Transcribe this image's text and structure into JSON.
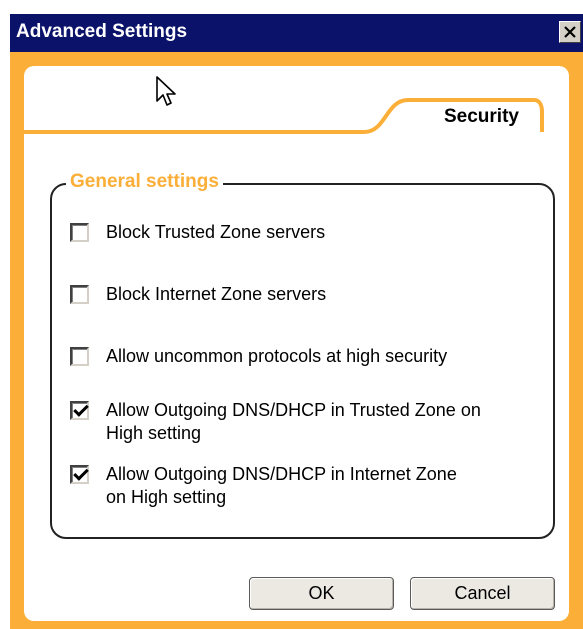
{
  "window": {
    "title": "Advanced Settings"
  },
  "tab": {
    "label": "Security"
  },
  "group": {
    "legend": "General settings",
    "options": [
      {
        "label": "Block Trusted Zone servers",
        "checked": false
      },
      {
        "label": "Block Internet Zone servers",
        "checked": false
      },
      {
        "label": "Allow uncommon protocols at high security",
        "checked": false
      },
      {
        "label": "Allow Outgoing DNS/DHCP in Trusted Zone on High setting",
        "checked": true
      },
      {
        "label": "Allow Outgoing DNS/DHCP in Internet Zone on High setting",
        "checked": true
      }
    ]
  },
  "buttons": {
    "ok": "OK",
    "cancel": "Cancel"
  },
  "colors": {
    "title_bar": "#0a126a",
    "accent": "#fbaf38"
  },
  "icons": {
    "close": "close-icon",
    "cursor": "mouse-pointer-icon"
  }
}
